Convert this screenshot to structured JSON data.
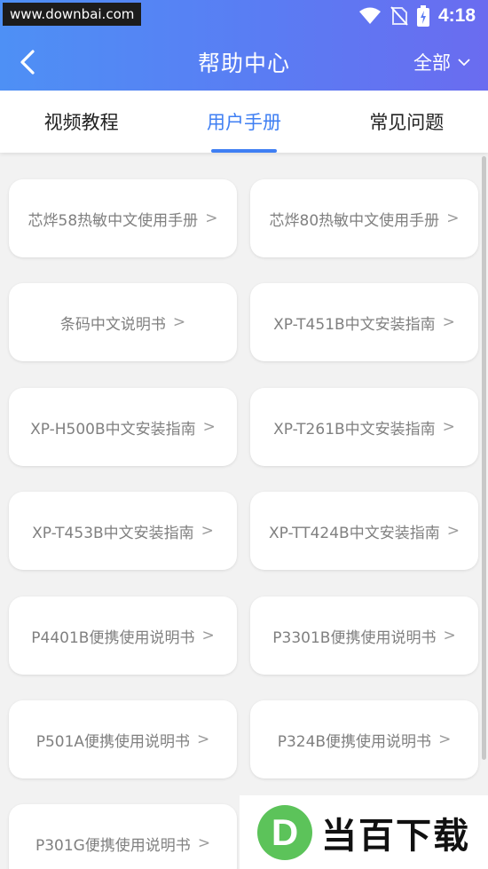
{
  "watermark_top": "www.downbai.com",
  "status": {
    "time": "4:18"
  },
  "header": {
    "title": "帮助中心",
    "filter_label": "全部"
  },
  "tabs": [
    {
      "label": "视频教程"
    },
    {
      "label": "用户手册"
    },
    {
      "label": "常见问题"
    }
  ],
  "manuals": [
    {
      "label": "芯烨58热敏中文使用手册"
    },
    {
      "label": "芯烨80热敏中文使用手册"
    },
    {
      "label": "条码中文说明书"
    },
    {
      "label": "XP-T451B中文安装指南"
    },
    {
      "label": "XP-H500B中文安装指南"
    },
    {
      "label": "XP-T261B中文安装指南"
    },
    {
      "label": "XP-T453B中文安装指南"
    },
    {
      "label": "XP-TT424B中文安装指南"
    },
    {
      "label": "P4401B便携使用说明书"
    },
    {
      "label": "P3301B便携使用说明书"
    },
    {
      "label": "P501A便携使用说明书"
    },
    {
      "label": "P324B便携使用说明书"
    },
    {
      "label": "P301G便携使用说明书"
    }
  ],
  "chevron": ">",
  "logo": {
    "letter": "D",
    "text": "当百下载"
  },
  "colors": {
    "accent": "#3f7ff3",
    "header_start": "#4e90f5",
    "header_end": "#6a6cf0"
  }
}
